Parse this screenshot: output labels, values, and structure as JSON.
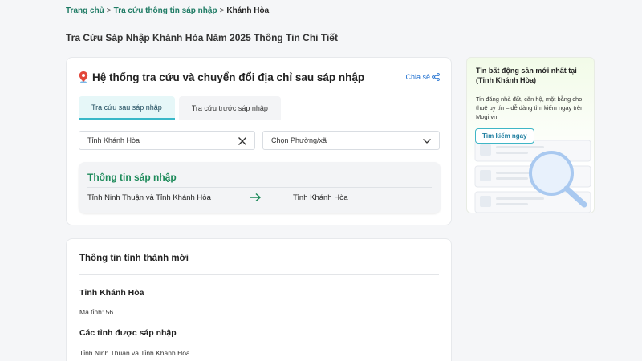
{
  "breadcrumb": {
    "home": "Trang chủ",
    "lookup": "Tra cứu thông tin sáp nhập",
    "current": "Khánh Hòa",
    "separator": ">"
  },
  "page": {
    "title": "Tra Cứu Sáp Nhập Khánh Hòa Năm 2025 Thông Tin Chi Tiết"
  },
  "tool": {
    "title": "Hệ thống tra cứu và chuyển đổi địa chỉ sau sáp nhập",
    "share_label": "Chia sẻ",
    "tabs": [
      {
        "label": "Tra cứu sau sáp nhập",
        "active": true
      },
      {
        "label": "Tra cứu trước sáp nhập",
        "active": false
      }
    ],
    "province_select": {
      "value": "Tỉnh Khánh Hòa"
    },
    "ward_select": {
      "value": "Chọn Phường/xã"
    },
    "merge": {
      "title": "Thông tin sáp nhập",
      "from": "Tỉnh Ninh Thuận và Tỉnh Khánh Hòa",
      "to": "Tỉnh Khánh Hòa"
    }
  },
  "info": {
    "title": "Thông tin tỉnh thành mới",
    "province_name": "Tỉnh Khánh Hòa",
    "code": "Mã tỉnh: 56",
    "merged_heading": "Các tỉnh được sáp nhập",
    "merged_list": "Tỉnh Ninh Thuận và Tỉnh Khánh Hòa"
  },
  "ad": {
    "title": "Tin bất động sản mới nhất tại (Tỉnh Khánh Hòa)",
    "description": "Tin đăng nhà đất, căn hộ, mặt bằng cho thuê uy tín – dễ dàng tìm kiếm ngay trên Mogi.vn",
    "button": "Tìm kiếm ngay"
  },
  "colors": {
    "accent_green": "#1d8a5a",
    "link_blue": "#1e6fd0",
    "tab_active_bg": "#e6f7f8",
    "teal": "#39b8c8"
  },
  "icons": [
    "map-pin-icon",
    "share-icon",
    "clear-icon",
    "chevron-down-icon",
    "arrow-right-icon",
    "magnifier-icon"
  ]
}
